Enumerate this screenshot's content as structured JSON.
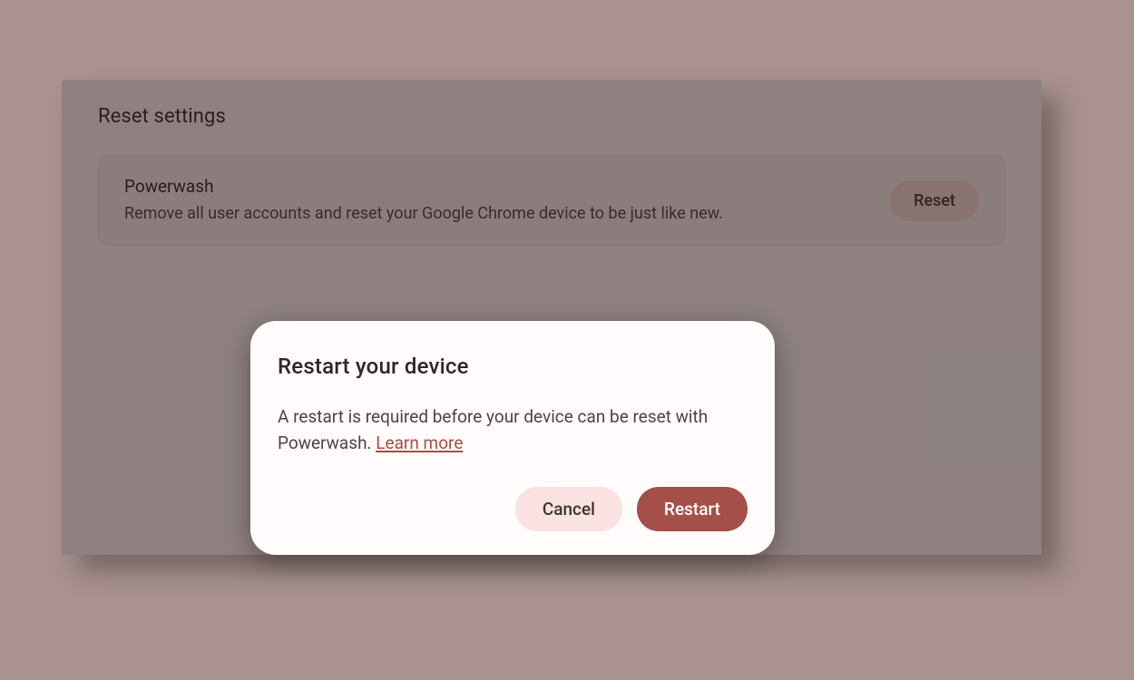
{
  "settings": {
    "section_title": "Reset settings",
    "powerwash": {
      "title": "Powerwash",
      "description": "Remove all user accounts and reset your Google Chrome device to be just like new.",
      "reset_button": "Reset"
    }
  },
  "dialog": {
    "title": "Restart your device",
    "body_text": "A restart is required before your device can be reset with Powerwash. ",
    "learn_more": "Learn more",
    "cancel_label": "Cancel",
    "restart_label": "Restart"
  },
  "colors": {
    "background": "#a9928f",
    "panel": "#fcf8f8",
    "row_bg": "#f6f1f1",
    "accent": "#a45049",
    "accent_light": "#f9e2e1",
    "link": "#a84c44"
  }
}
